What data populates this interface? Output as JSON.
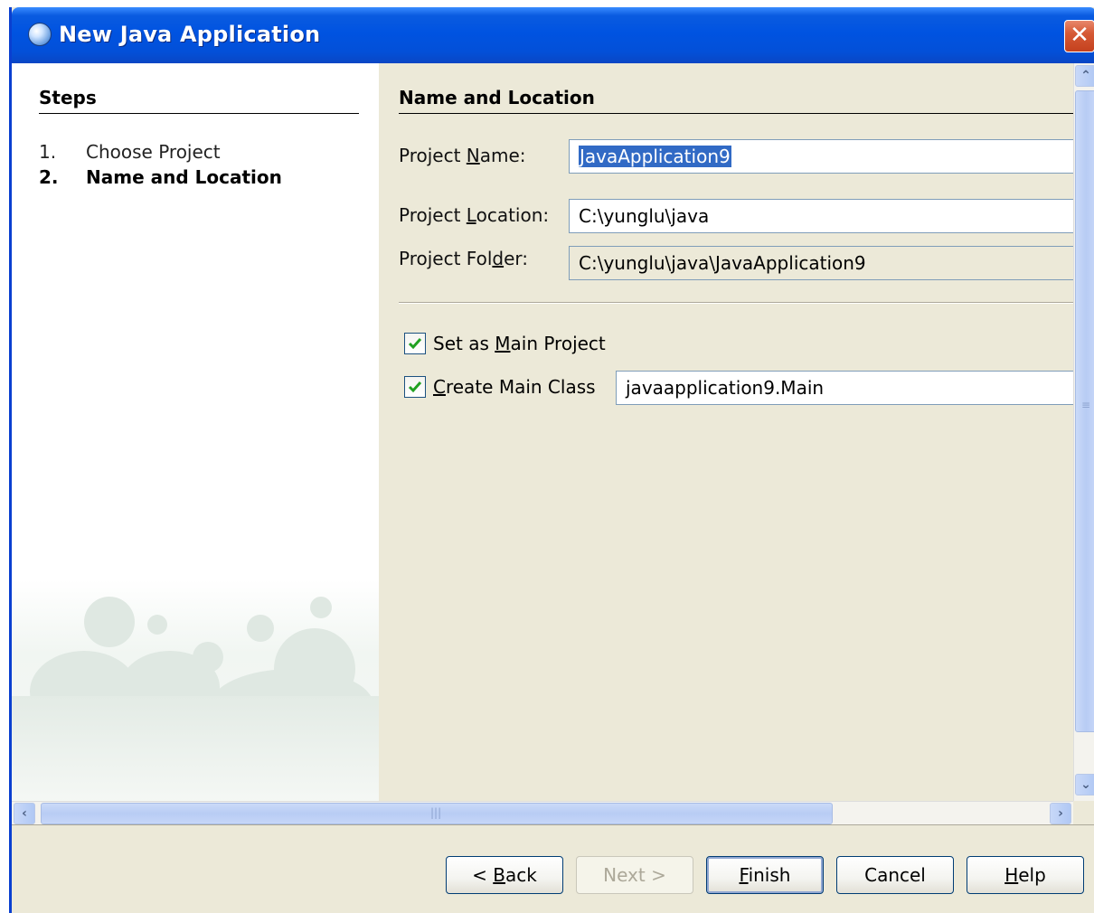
{
  "window": {
    "title": "New Java Application"
  },
  "steps": {
    "title": "Steps",
    "items": [
      {
        "number": "1.",
        "label": "Choose Project"
      },
      {
        "number": "2.",
        "label": "Name and Location"
      }
    ]
  },
  "form": {
    "section_title": "Name and Location",
    "project_name": {
      "label": "Project Name:",
      "value": "JavaApplication9"
    },
    "project_location": {
      "label": "Project Location:",
      "value": "C:\\yunglu\\java"
    },
    "project_folder": {
      "label": "Project Folder:",
      "value": "C:\\yunglu\\java\\JavaApplication9"
    },
    "set_main_project": {
      "label": "Set as Main Project",
      "checked": true
    },
    "create_main_class": {
      "label": "Create Main Class",
      "checked": true,
      "value": "javaapplication9.Main"
    }
  },
  "buttons": {
    "back": "< Back",
    "next": "Next >",
    "finish": "Finish",
    "cancel": "Cancel",
    "help": "Help"
  },
  "colors": {
    "titlebar": "#0053e1",
    "dialog_bg": "#ece9d8",
    "selection": "#316ac5"
  }
}
